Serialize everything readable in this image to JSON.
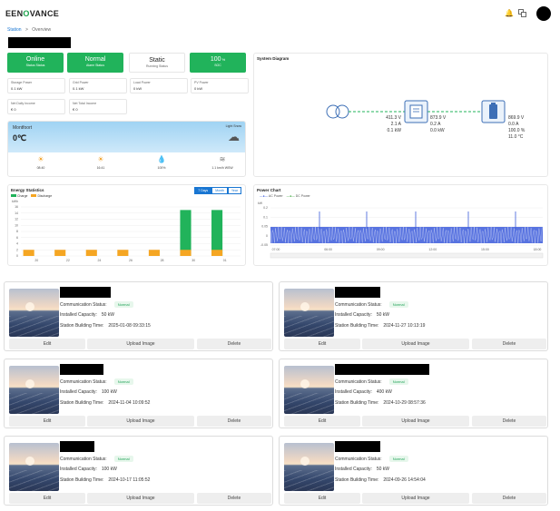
{
  "header": {
    "logo_prefix": "EEN",
    "logo_accent": "O",
    "logo_suffix": "VANCE",
    "icons": [
      "bell-icon",
      "translate-icon"
    ]
  },
  "breadcrumb": {
    "station": "Station",
    "sep": ">",
    "overview": "Overview"
  },
  "status_cards": [
    {
      "value": "Online",
      "label": "Status Status"
    },
    {
      "value": "Normal",
      "label": "Alarm Status"
    },
    {
      "value": "Static",
      "label": "Running Status"
    },
    {
      "value": "100",
      "unit": "%",
      "label": "SOC"
    }
  ],
  "metrics": [
    {
      "label": "Storage Power",
      "value": "0.1 kW"
    },
    {
      "label": "Grid Power",
      "value": "0.1 kW"
    },
    {
      "label": "Load Power",
      "value": "0 kW"
    },
    {
      "label": "PV Power",
      "value": "0 kW"
    },
    {
      "label": "Net Daily Income",
      "value": "€ 0"
    },
    {
      "label": "Net Total Income",
      "value": "€ 0"
    }
  ],
  "weather": {
    "city": "Montfoort",
    "temp": "0℃",
    "description": "Light Snow",
    "items": [
      "08:40",
      "16:41",
      "100%",
      "1.1 km/h WSW"
    ],
    "icons": [
      "sunrise-icon",
      "sunset-icon",
      "humidity-icon",
      "wind-icon"
    ]
  },
  "system_diagram": {
    "title": "System Diagram",
    "grid": [
      "411.3 V",
      "2.1 A",
      "0.1 kW"
    ],
    "inverter": [
      "873.9 V",
      "0.2 A",
      "0.0 kW"
    ],
    "battery": [
      "869.9 V",
      "0.0 A",
      "100.0 %",
      "11.0 °C"
    ]
  },
  "energy_chart": {
    "title": "Energy Statistics",
    "unit": "kWh",
    "buttons": [
      "7 Days",
      "Month",
      "Year"
    ]
  },
  "power_chart": {
    "title": "Power Chart",
    "unit": "kW"
  },
  "chart_data": [
    {
      "type": "bar",
      "title": "Energy Statistics",
      "ylabel": "kWh",
      "ylim": [
        0,
        16
      ],
      "yticks": [
        0,
        2,
        4,
        6,
        8,
        10,
        12,
        14,
        16
      ],
      "categories": [
        "20",
        "21",
        "22",
        "23",
        "24",
        "25",
        "26",
        "27",
        "28",
        "29",
        "30",
        "31",
        "01",
        "02"
      ],
      "xtick_labels": [
        "20",
        "",
        "22",
        "",
        "24",
        "",
        "26",
        "",
        "28",
        "",
        "30",
        "",
        "01",
        ""
      ],
      "series": [
        {
          "name": "Charge",
          "color": "#21b35b",
          "values": [
            0,
            0,
            0,
            0,
            0,
            0,
            0,
            0,
            0,
            0,
            15,
            0,
            15,
            0
          ]
        },
        {
          "name": "Discharge",
          "color": "#f5a623",
          "values": [
            2,
            0,
            2,
            0,
            2,
            0,
            2,
            0,
            2,
            0,
            2,
            0,
            2,
            0
          ]
        }
      ],
      "legend": "top-left",
      "grid": true
    },
    {
      "type": "line",
      "title": "Power Chart",
      "ylabel": "kW",
      "ylim": [
        -0.05,
        0.2
      ],
      "yticks": [
        "0.2",
        "0.1",
        "0.05",
        "0",
        "-0.05"
      ],
      "xtick_labels": [
        "07:00",
        "06:00",
        "09:00",
        "12:00",
        "15:00",
        "18:00"
      ],
      "series": [
        {
          "name": "AC Power",
          "color": "#3b5bdb"
        },
        {
          "name": "DC Power",
          "color": "#2ca02c"
        }
      ],
      "legend": "top-left",
      "grid": true
    }
  ],
  "stations": [
    {
      "status_label": "Communication Status:",
      "status": "Normal",
      "capacity_label": "Installed Capacity:",
      "capacity": "50 kW",
      "time_label": "Station Building Time:",
      "time": "2025-01-08 09:33:15",
      "edit": "Edit",
      "upload": "Upload Image",
      "delete": "Delete"
    },
    {
      "status_label": "Communication Status:",
      "status": "Normal",
      "capacity_label": "Installed Capacity:",
      "capacity": "50 kW",
      "time_label": "Station Building Time:",
      "time": "2024-11-27 10:13:19",
      "edit": "Edit",
      "upload": "Upload Image",
      "delete": "Delete"
    },
    {
      "status_label": "Communication Status:",
      "status": "Normal",
      "capacity_label": "Installed Capacity:",
      "capacity": "100 kW",
      "time_label": "Station Building Time:",
      "time": "2024-11-04 10:09:52",
      "edit": "Edit",
      "upload": "Upload Image",
      "delete": "Delete"
    },
    {
      "status_label": "Communication Status:",
      "status": "Normal",
      "capacity_label": "Installed Capacity:",
      "capacity": "400 kW",
      "time_label": "Station Building Time:",
      "time": "2024-10-29 08:57:36",
      "edit": "Edit",
      "upload": "Upload Image",
      "delete": "Delete"
    },
    {
      "status_label": "Communication Status:",
      "status": "Normal",
      "capacity_label": "Installed Capacity:",
      "capacity": "100 kW",
      "time_label": "Station Building Time:",
      "time": "2024-10-17 11:05:52",
      "edit": "Edit",
      "upload": "Upload Image",
      "delete": "Delete"
    },
    {
      "status_label": "Communication Status:",
      "status": "Normal",
      "capacity_label": "Installed Capacity:",
      "capacity": "50 kW",
      "time_label": "Station Building Time:",
      "time": "2024-09-26 14:54:04",
      "edit": "Edit",
      "upload": "Upload Image",
      "delete": "Delete"
    }
  ]
}
